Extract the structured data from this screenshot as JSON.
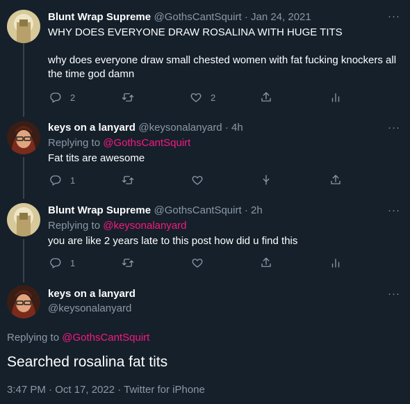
{
  "tweets": [
    {
      "name": "Blunt Wrap Supreme",
      "meta": "@GothsCantSquirt · Jan 24, 2021",
      "text_line1": "WHY DOES EVERYONE DRAW ROSALINA WITH HUGE TITS",
      "text_line2": "why does everyone draw small chested women with fat fucking knockers all",
      "text_line3": "the time god damn",
      "replies": "2",
      "likes": "2"
    },
    {
      "name": "keys on a lanyard",
      "meta": "@keysonalanyard · 4h",
      "replying_prefix": "Replying to",
      "replying_to": "@GothsCantSquirt",
      "text": "Fat tits are awesome",
      "replies": "1"
    },
    {
      "name": "Blunt Wrap Supreme",
      "meta": "@GothsCantSquirt · 2h",
      "replying_prefix": "Replying to",
      "replying_to": "@keysonalanyard",
      "text": "you are like 2 years late to this post how did u find this",
      "replies": "1"
    }
  ],
  "main": {
    "name": "keys on a lanyard",
    "handle": "@keysonalanyard",
    "replying_prefix": "Replying to",
    "replying_to": "@GothsCantSquirt",
    "text": "Searched rosalina fat tits",
    "timestamp": "3:47 PM · Oct 17, 2022 · Twitter for iPhone"
  },
  "ui": {
    "more": "···"
  },
  "colors": {
    "background": "#15202b",
    "secondary_text": "#8b98a5",
    "mention": "#f91880",
    "thread_line": "#38444d"
  },
  "icons": [
    "reply-icon",
    "retweet-icon",
    "like-icon",
    "share-icon",
    "analytics-icon",
    "download-icon"
  ]
}
